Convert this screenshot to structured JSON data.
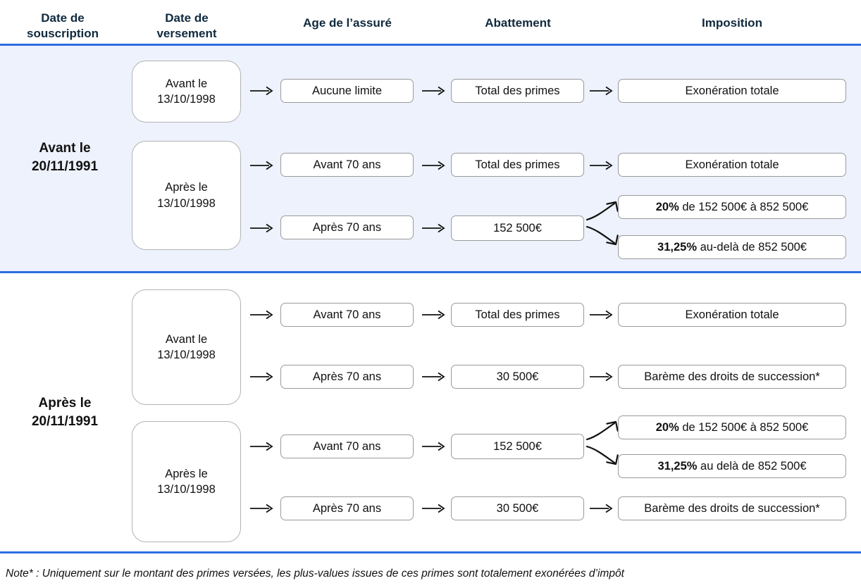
{
  "headers": [
    {
      "label": "Date de\nsouscription"
    },
    {
      "label": "Date de\nversement"
    },
    {
      "label": "Age de l’assuré"
    },
    {
      "label": "Abattement"
    },
    {
      "label": "Imposition"
    }
  ],
  "colors": {
    "rule": "#2b6ee0",
    "band": "#edf2fc",
    "header_text": "#10293d",
    "box_border": "#9a9a9a",
    "text": "#111111"
  },
  "groups": [
    {
      "label": "Avant le\n20/11/1991",
      "versement": [
        {
          "label": "Avant le\n13/10/1998"
        },
        {
          "label": "Après le\n13/10/1998"
        }
      ],
      "rows": [
        {
          "age": "Aucune limite",
          "abattement": "Total des primes",
          "imposition": [
            {
              "bold": "",
              "rest": "Exonération totale"
            }
          ]
        },
        {
          "age": "Avant 70 ans",
          "abattement": "Total des primes",
          "imposition": [
            {
              "bold": "",
              "rest": "Exonération totale"
            }
          ]
        },
        {
          "age": "Après 70 ans",
          "abattement": "152 500€",
          "imposition": [
            {
              "bold": "20%",
              "rest": " de 152 500€ à 852 500€"
            },
            {
              "bold": "31,25%",
              "rest": " au-delà de 852 500€"
            }
          ]
        }
      ]
    },
    {
      "label": "Après le\n20/11/1991",
      "versement": [
        {
          "label": "Avant le\n13/10/1998"
        },
        {
          "label": "Après le\n13/10/1998"
        }
      ],
      "rows": [
        {
          "age": "Avant 70 ans",
          "abattement": "Total des primes",
          "imposition": [
            {
              "bold": "",
              "rest": "Exonération totale"
            }
          ]
        },
        {
          "age": "Après 70 ans",
          "abattement": "30 500€",
          "imposition": [
            {
              "bold": "",
              "rest": "Barème des droits de succession*"
            }
          ]
        },
        {
          "age": "Avant 70 ans",
          "abattement": "152 500€",
          "imposition": [
            {
              "bold": "20%",
              "rest": " de 152 500€ à 852 500€"
            },
            {
              "bold": "31,25%",
              "rest": " au delà de 852 500€"
            }
          ]
        },
        {
          "age": "Après 70 ans",
          "abattement": "30 500€",
          "imposition": [
            {
              "bold": "",
              "rest": "Barème des droits de succession*"
            }
          ]
        }
      ]
    }
  ],
  "footnote": "Note* : Uniquement sur le montant des primes versées, les plus-values issues de ces primes sont totalement exonérées d’impôt",
  "text": {
    "h0": "Date de\nsouscription",
    "h1": "Date de\nversement",
    "h2": "Age de l’assuré",
    "h3": "Abattement",
    "h4": "Imposition",
    "g0_label": "Avant le\n20/11/1991",
    "g1_label": "Après le\n20/11/1991",
    "g0_v0": "Avant le\n13/10/1998",
    "g0_v1": "Après le\n13/10/1998",
    "g1_v0": "Avant le\n13/10/1998",
    "g1_v1": "Après le\n13/10/1998",
    "r1_age": "Aucune limite",
    "r1_ab": "Total des primes",
    "r1_imp": "Exonération totale",
    "r2_age": "Avant 70 ans",
    "r2_ab": "Total des primes",
    "r2_imp": "Exonération totale",
    "r3_age": "Après 70 ans",
    "r3_ab": "152 500€",
    "r3_imp_a_bold": "20%",
    "r3_imp_a_rest": " de 152 500€ à 852 500€",
    "r3_imp_b_bold": "31,25%",
    "r3_imp_b_rest": " au-delà de 852 500€",
    "r4_age": "Avant 70 ans",
    "r4_ab": "Total des primes",
    "r4_imp": "Exonération totale",
    "r5_age": "Après 70 ans",
    "r5_ab": "30 500€",
    "r5_imp": "Barème des droits de succession*",
    "r6_age": "Avant 70 ans",
    "r6_ab": "152 500€",
    "r6_imp_a_bold": "20%",
    "r6_imp_a_rest": " de 152 500€ à 852 500€",
    "r6_imp_b_bold": "31,25%",
    "r6_imp_b_rest": " au delà de 852 500€",
    "r7_age": "Après 70 ans",
    "r7_ab": "30 500€",
    "r7_imp": "Barème des droits de succession*",
    "footnote": "Note* : Uniquement sur le montant des primes versées, les plus-values issues de ces primes sont totalement exonérées d’impôt"
  }
}
